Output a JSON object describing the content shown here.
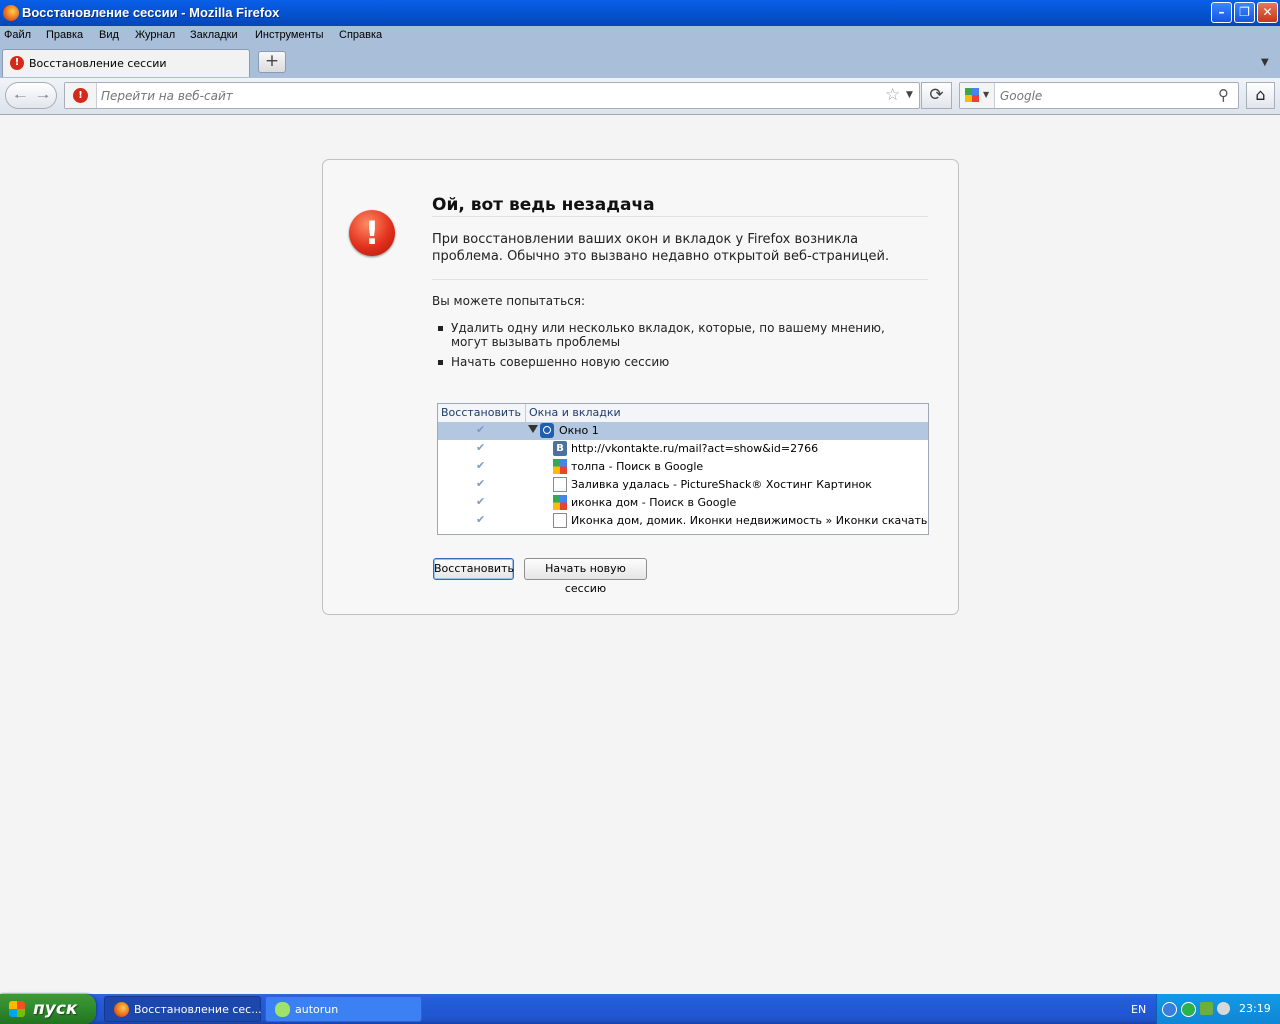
{
  "window": {
    "title": "Восстановление сессии - Mozilla Firefox"
  },
  "menu": [
    "Файл",
    "Правка",
    "Вид",
    "Журнал",
    "Закладки",
    "Инструменты",
    "Справка"
  ],
  "tab": {
    "label": "Восстановление сессии",
    "new_tab_symbol": "+"
  },
  "navbar": {
    "url_placeholder": "Перейти на веб-сайт",
    "search_placeholder": "Google",
    "search_engine": "google-icon"
  },
  "page": {
    "heading": "Ой, вот ведь незадача",
    "description": "При восстановлении ваших окон и вкладок у Firefox возникла проблема. Обычно это вызвано недавно открытой веб-страницей.",
    "try_label": "Вы можете попытаться:",
    "bullets": [
      "Удалить одну или несколько вкладок, которые, по вашему мнению, могут вызывать проблемы",
      "Начать совершенно новую сессию"
    ],
    "tree": {
      "columns": [
        "Восстановить",
        "Окна и вкладки"
      ],
      "rows": [
        {
          "label": "Окно 1",
          "icon": "window-icon",
          "checked": true,
          "selected": true
        },
        {
          "label": "http://vkontakte.ru/mail?act=show&id=2766",
          "icon": "vk-icon",
          "checked": true
        },
        {
          "label": "толпа - Поиск в Google",
          "icon": "google-icon",
          "checked": true
        },
        {
          "label": "Заливка удалась - PictureShack® Хостинг Картинок",
          "icon": "page-icon",
          "checked": true
        },
        {
          "label": "иконка дом - Поиск в Google",
          "icon": "google-icon",
          "checked": true
        },
        {
          "label": "Иконка дом, домик. Иконки недвижимость » Иконки скачать беспл...",
          "icon": "page-icon",
          "checked": true
        }
      ]
    },
    "restore_button": "Восстановить",
    "new_session_button": "Начать новую сессию"
  },
  "taskbar": {
    "start_label": "пуск",
    "tasks": [
      "Восстановление сес...",
      "autorun"
    ],
    "language": "EN",
    "clock": "23:19"
  },
  "colors": {
    "titlebar": "#0655d6",
    "taskbar": "#245edb",
    "start_button": "#2f8a2c",
    "error_red": "#e2311c"
  }
}
